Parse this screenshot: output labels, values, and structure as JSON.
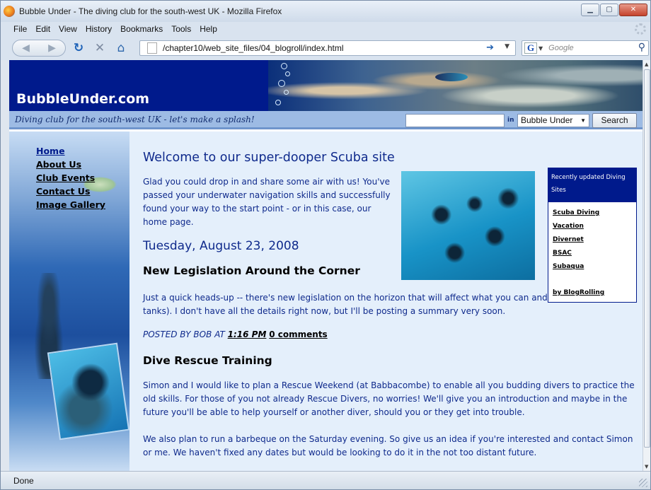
{
  "window": {
    "title": "Bubble Under - The diving club for the south-west UK - Mozilla Firefox"
  },
  "menu": [
    "File",
    "Edit",
    "View",
    "History",
    "Bookmarks",
    "Tools",
    "Help"
  ],
  "toolbar": {
    "url": "/chapter10/web_site_files/04_blogroll/index.html",
    "search_engine_icon": "G",
    "search_placeholder": "Google"
  },
  "site": {
    "title": "BubbleUnder.com",
    "tagline": "Diving club for the south-west UK - let's make a splash!",
    "search": {
      "in_label": "in",
      "scope": "Bubble Under",
      "button": "Search"
    },
    "nav": [
      "Home",
      "About Us",
      "Club Events",
      "Contact Us",
      "Image Gallery"
    ],
    "heading": "Welcome to our super-dooper Scuba site",
    "intro": "Glad you could drop in and share some air with us! You've passed your underwater navigation skills and successfully found your way to the start point - or in this case, our home page.",
    "date": "Tuesday, August 23, 2008",
    "posts": [
      {
        "title": "New Legislation Around the Corner",
        "body": "Just a quick heads-up -- there's new legislation on the horizon that will affect what you can and can't fill (as in tanks). I don't have all the details right now, but I'll be posting a summary very soon.",
        "posted_by": "POSTED BY BOB AT",
        "time": "1:16 PM",
        "comments": "0 comments"
      },
      {
        "title": "Dive Rescue Training",
        "paragraphs": [
          "Simon and I would like to plan a Rescue Weekend (at Babbacombe) to enable all you budding divers to practice the old skills. For those of you not already Rescue Divers, no worries! We'll give you an introduction and maybe in the future you'll be able to help yourself or another diver, should you or they get into trouble.",
          "We also plan to run a barbeque on the Saturday evening. So give us an idea if you're interested and contact Simon or me. We haven't fixed any dates but would be looking to do it in the not too distant future."
        ]
      }
    ],
    "blogroll": {
      "heading": "Recently updated Diving Sites",
      "links": [
        "Scuba Diving",
        "Vacation",
        "Divernet",
        "BSAC",
        "Subaqua"
      ],
      "by": "by BlogRolling"
    }
  },
  "status": "Done",
  "colors": {
    "brand_navy": "#001a8c",
    "tagbar": "#9dbbe4",
    "content_bg": "#e4effb"
  }
}
